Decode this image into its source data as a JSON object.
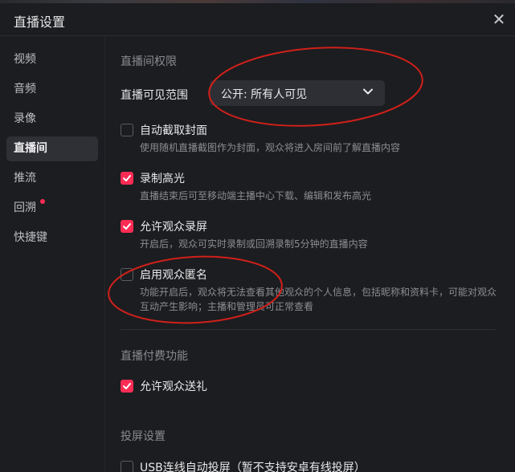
{
  "window": {
    "title": "直播设置",
    "close_glyph": "✕"
  },
  "sidebar": {
    "items": [
      {
        "label": "视频"
      },
      {
        "label": "音频"
      },
      {
        "label": "录像"
      },
      {
        "label": "直播间",
        "active": true
      },
      {
        "label": "推流"
      },
      {
        "label": "回溯",
        "badge_dot": true
      },
      {
        "label": "快捷键"
      }
    ]
  },
  "sections": {
    "room_permissions": {
      "title": "直播间权限",
      "visibility_label": "直播可见范围",
      "visibility_value": "公开: 所有人可见"
    },
    "options": [
      {
        "label": "自动截取封面",
        "checked": false,
        "desc": [
          "使用随机直播截图作为封面，观众将进入房间前了解直播内容"
        ]
      },
      {
        "label": "录制高光",
        "checked": true,
        "desc": [
          "直播结束后可至移动端主播中心下载、编辑和发布高光"
        ]
      },
      {
        "label": "允许观众录屏",
        "checked": true,
        "desc": [
          "开启后，观众可实时录制或回溯录制5分钟的直播内容"
        ]
      },
      {
        "label": "启用观众匿名",
        "checked": false,
        "desc": [
          "功能开启后，观众将无法查看其他观众的个人信息，包括昵称和资料卡，可能对观众",
          "互动产生影响；主播和管理员可正常查看"
        ]
      }
    ],
    "paid_features": {
      "title": "直播付费功能",
      "gift_label": "允许观众送礼",
      "gift_checked": true
    },
    "screen_cast": {
      "title": "投屏设置",
      "usb_label": "USB连线自动投屏（暂不支持安卓有线投屏）",
      "usb_checked": false
    }
  },
  "colors": {
    "accent": "#fe2c55",
    "annotation": "#d0201a"
  },
  "icons": {
    "close": "close-icon",
    "dropdown": "chevron-down-icon",
    "check": "checkmark-icon"
  }
}
